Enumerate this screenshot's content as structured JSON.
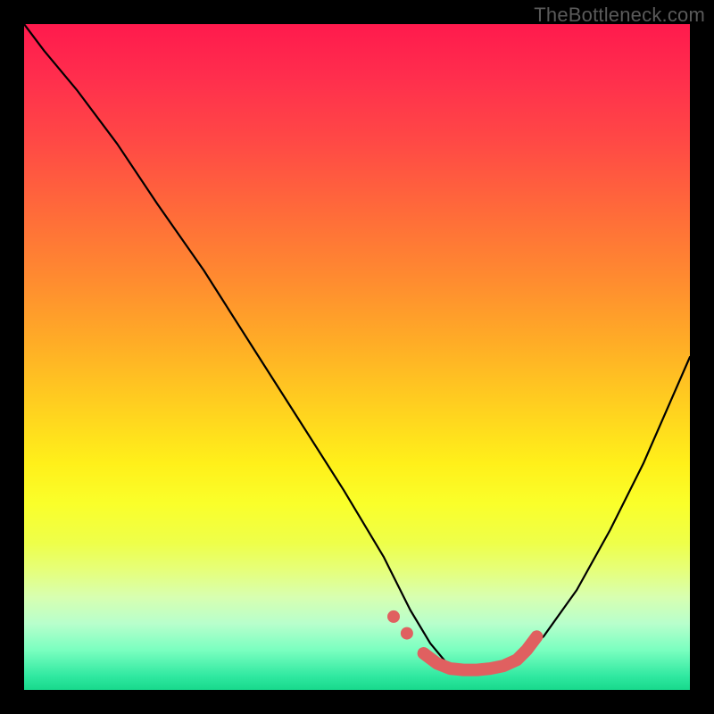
{
  "watermark": "TheBottleneck.com",
  "chart_data": {
    "type": "line",
    "title": "",
    "xlabel": "",
    "ylabel": "",
    "xlim": [
      0,
      100
    ],
    "ylim": [
      0,
      100
    ],
    "series": [
      {
        "name": "bottleneck-curve",
        "x": [
          0,
          3,
          8,
          14,
          20,
          27,
          34,
          41,
          48,
          54,
          58,
          61,
          63.5,
          66,
          69,
          73,
          78,
          83,
          88,
          93,
          100
        ],
        "y": [
          100,
          96,
          90,
          82,
          73,
          63,
          52,
          41,
          30,
          20,
          12,
          7,
          4,
          3,
          3,
          4,
          8,
          15,
          24,
          34,
          50
        ]
      }
    ],
    "highlight_points": {
      "name": "near-zero-band",
      "x": [
        55.5,
        57.5,
        60,
        62,
        64,
        66,
        68,
        70,
        72,
        74,
        75.5,
        77
      ],
      "y": [
        11,
        8.5,
        5.5,
        4,
        3.2,
        3,
        3,
        3.2,
        3.6,
        4.5,
        6,
        8
      ]
    },
    "colors": {
      "curve": "#000000",
      "highlight": "#e06060",
      "background_top": "#ff1a4d",
      "background_bottom": "#18d98c"
    }
  }
}
